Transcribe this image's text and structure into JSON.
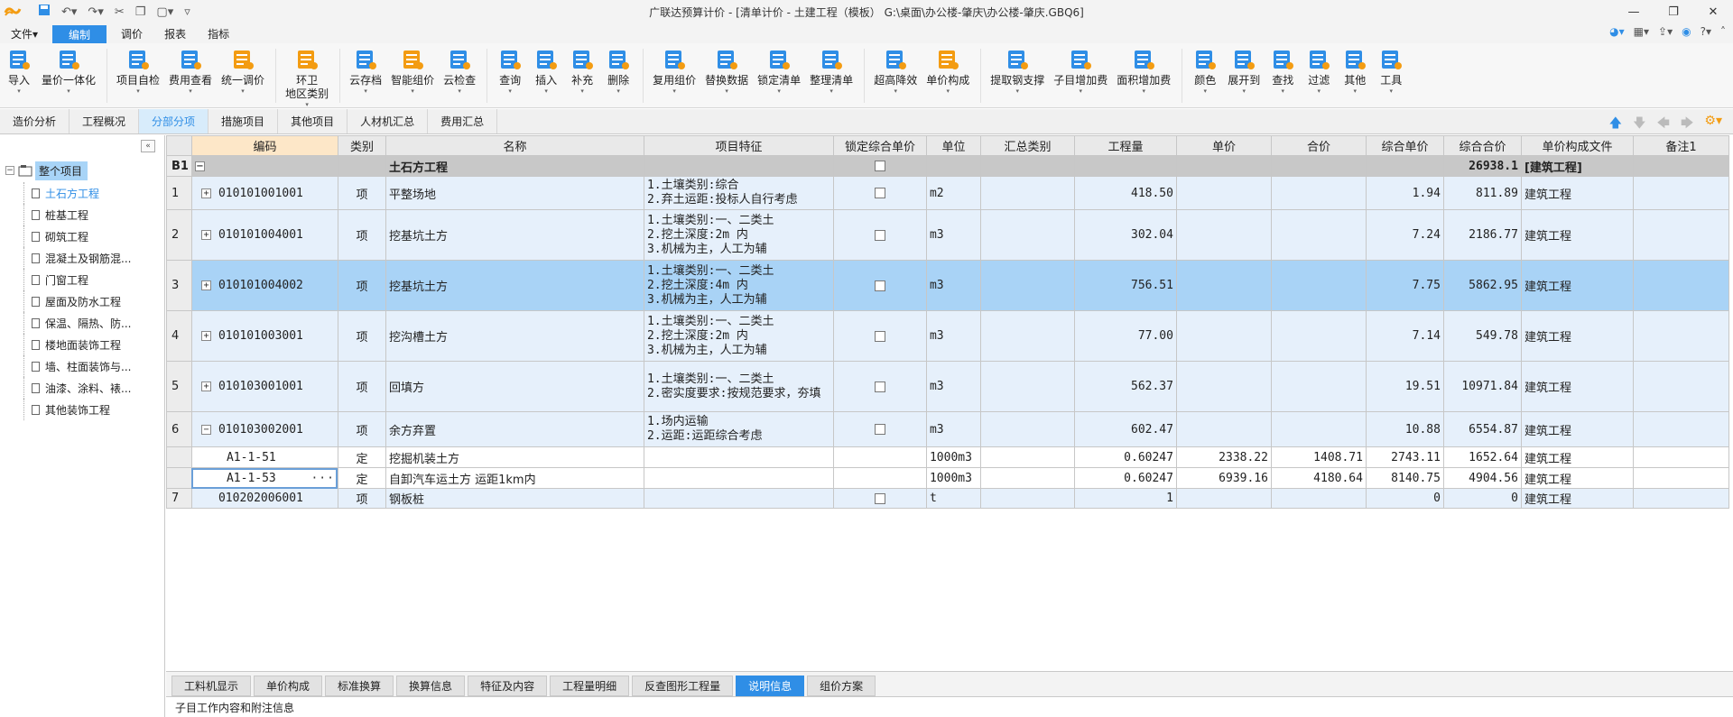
{
  "titlebar": {
    "title": "广联达预算计价 - [清单计价 - 土建工程（模板）  G:\\桌面\\办公楼-肇庆\\办公楼-肇庆.GBQ6]"
  },
  "menus": [
    {
      "label": "文件▾"
    },
    {
      "label": "编制"
    },
    {
      "label": "调价"
    },
    {
      "label": "报表"
    },
    {
      "label": "指标"
    }
  ],
  "toolbar": [
    {
      "label": "导入",
      "icon": "import-icon",
      "color": "#2f8ee6"
    },
    {
      "label": "量价一体化",
      "icon": "quantity-price-icon",
      "color": "#2f8ee6"
    },
    {
      "label": "项目自检",
      "icon": "self-check-icon",
      "color": "#2f8ee6"
    },
    {
      "label": "费用查看",
      "icon": "fee-view-icon",
      "color": "#2f8ee6"
    },
    {
      "label": "统一调价",
      "icon": "unified-adjust-icon",
      "color": "#f39c12"
    },
    {
      "label": "环卫\n地区类别",
      "icon": "sanitation-icon",
      "color": "#f39c12"
    },
    {
      "label": "云存档",
      "icon": "cloud-save-icon",
      "color": "#2f8ee6"
    },
    {
      "label": "智能组价",
      "icon": "smart-pricing-icon",
      "color": "#f39c12"
    },
    {
      "label": "云检查",
      "icon": "cloud-check-icon",
      "color": "#2f8ee6"
    },
    {
      "label": "查询",
      "icon": "query-icon",
      "color": "#2f8ee6"
    },
    {
      "label": "插入",
      "icon": "insert-icon",
      "color": "#2f8ee6"
    },
    {
      "label": "补充",
      "icon": "supplement-icon",
      "color": "#2f8ee6"
    },
    {
      "label": "删除",
      "icon": "delete-icon",
      "color": "#2f8ee6"
    },
    {
      "label": "复用组价",
      "icon": "reuse-pricing-icon",
      "color": "#2f8ee6"
    },
    {
      "label": "替换数据",
      "icon": "replace-data-icon",
      "color": "#2f8ee6"
    },
    {
      "label": "锁定清单",
      "icon": "lock-list-icon",
      "color": "#2f8ee6"
    },
    {
      "label": "整理清单",
      "icon": "organize-list-icon",
      "color": "#2f8ee6"
    },
    {
      "label": "超高降效",
      "icon": "high-efficiency-icon",
      "color": "#2f8ee6"
    },
    {
      "label": "单价构成",
      "icon": "price-composition-icon",
      "color": "#f39c12"
    },
    {
      "label": "提取钢支撑",
      "icon": "steel-support-icon",
      "color": "#2f8ee6"
    },
    {
      "label": "子目增加费",
      "icon": "sub-item-fee-icon",
      "color": "#2f8ee6"
    },
    {
      "label": "面积增加费",
      "icon": "area-fee-icon",
      "color": "#2f8ee6"
    },
    {
      "label": "颜色",
      "icon": "color-icon",
      "color": "#2f8ee6"
    },
    {
      "label": "展开到",
      "icon": "expand-to-icon",
      "color": "#2f8ee6"
    },
    {
      "label": "查找",
      "icon": "find-icon",
      "color": "#2f8ee6"
    },
    {
      "label": "过滤",
      "icon": "filter-icon",
      "color": "#2f8ee6"
    },
    {
      "label": "其他",
      "icon": "other-icon",
      "color": "#2f8ee6"
    },
    {
      "label": "工具",
      "icon": "tools-icon",
      "color": "#2f8ee6"
    }
  ],
  "tabs": [
    {
      "label": "造价分析"
    },
    {
      "label": "工程概况"
    },
    {
      "label": "分部分项"
    },
    {
      "label": "措施项目"
    },
    {
      "label": "其他项目"
    },
    {
      "label": "人材机汇总"
    },
    {
      "label": "费用汇总"
    }
  ],
  "tree": {
    "root": "整个项目",
    "items": [
      "土石方工程",
      "桩基工程",
      "砌筑工程",
      "混凝土及钢筋混...",
      "门窗工程",
      "屋面及防水工程",
      "保温、隔热、防...",
      "楼地面装饰工程",
      "墙、柱面装饰与...",
      "油漆、涂料、裱...",
      "其他装饰工程"
    ]
  },
  "grid": {
    "headers": [
      "编码",
      "类别",
      "名称",
      "项目特征",
      "锁定综合单价",
      "单位",
      "汇总类别",
      "工程量",
      "单价",
      "合价",
      "综合单价",
      "综合合价",
      "单价构成文件",
      "备注1"
    ],
    "section": {
      "id": "B1",
      "name": "土石方工程",
      "total": "26938.1",
      "file": "[建筑工程]"
    },
    "rows": [
      {
        "no": "1",
        "code": "010101001001",
        "type": "项",
        "name": "平整场地",
        "feat": "1.土壤类别:综合\n2.弃土运距:投标人自行考虑",
        "unit": "m2",
        "qty": "418.50",
        "price": "",
        "amount": "",
        "unitPrice": "1.94",
        "total": "811.89",
        "file": "建筑工程"
      },
      {
        "no": "2",
        "code": "010101004001",
        "type": "项",
        "name": "挖基坑土方",
        "feat": "1.土壤类别:一、二类土\n2.挖土深度:2m 内\n3.机械为主，人工为辅",
        "unit": "m3",
        "qty": "302.04",
        "price": "",
        "amount": "",
        "unitPrice": "7.24",
        "total": "2186.77",
        "file": "建筑工程"
      },
      {
        "no": "3",
        "code": "010101004002",
        "type": "项",
        "name": "挖基坑土方",
        "feat": "1.土壤类别:一、二类土\n2.挖土深度:4m 内\n3.机械为主，人工为辅",
        "unit": "m3",
        "qty": "756.51",
        "price": "",
        "amount": "",
        "unitPrice": "7.75",
        "total": "5862.95",
        "file": "建筑工程"
      },
      {
        "no": "4",
        "code": "010101003001",
        "type": "项",
        "name": "挖沟槽土方",
        "feat": "1.土壤类别:一、二类土\n2.挖土深度:2m 内\n3.机械为主，人工为辅",
        "unit": "m3",
        "qty": "77.00",
        "price": "",
        "amount": "",
        "unitPrice": "7.14",
        "total": "549.78",
        "file": "建筑工程"
      },
      {
        "no": "5",
        "code": "010103001001",
        "type": "项",
        "name": "回填方",
        "feat": "1.土壤类别:一、二类土\n2.密实度要求:按规范要求，夯填",
        "unit": "m3",
        "qty": "562.37",
        "price": "",
        "amount": "",
        "unitPrice": "19.51",
        "total": "10971.84",
        "file": "建筑工程"
      },
      {
        "no": "6",
        "code": "010103002001",
        "type": "项",
        "name": "余方弃置",
        "feat": "1.场内运输\n2.运距:运距综合考虑",
        "unit": "m3",
        "qty": "602.47",
        "price": "",
        "amount": "",
        "unitPrice": "10.88",
        "total": "6554.87",
        "file": "建筑工程"
      },
      {
        "no": "",
        "code": "A1-1-51",
        "type": "定",
        "name": "挖掘机装土方",
        "feat": "",
        "unit": "1000m3",
        "qty": "0.60247",
        "price": "2338.22",
        "amount": "1408.71",
        "unitPrice": "2743.11",
        "total": "1652.64",
        "file": "建筑工程"
      },
      {
        "no": "",
        "code": "A1-1-53",
        "type": "定",
        "name": "自卸汽车运土方 运距1km内",
        "feat": "",
        "unit": "1000m3",
        "qty": "0.60247",
        "price": "6939.16",
        "amount": "4180.64",
        "unitPrice": "8140.75",
        "total": "4904.56",
        "file": "建筑工程"
      },
      {
        "no": "7",
        "code": "010202006001",
        "type": "项",
        "name": "钢板桩",
        "feat": "",
        "unit": "t",
        "qty": "1",
        "price": "",
        "amount": "",
        "unitPrice": "0",
        "total": "0",
        "file": "建筑工程"
      }
    ]
  },
  "bottom_tabs": [
    {
      "label": "工料机显示"
    },
    {
      "label": "单价构成"
    },
    {
      "label": "标准换算"
    },
    {
      "label": "换算信息"
    },
    {
      "label": "特征及内容"
    },
    {
      "label": "工程量明细"
    },
    {
      "label": "反查图形工程量"
    },
    {
      "label": "说明信息"
    },
    {
      "label": "组价方案"
    }
  ],
  "bottom_info": "子目工作内容和附注信息",
  "ellipsis": "···"
}
